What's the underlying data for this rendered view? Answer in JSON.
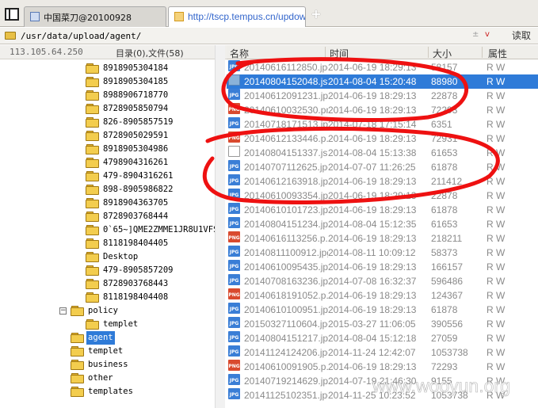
{
  "tabs": [
    {
      "label": "中国菜刀@20100928",
      "active": false
    },
    {
      "label": "http://tscp.tempus.cn/updow...",
      "active": true
    }
  ],
  "new_tab_symbol": "+",
  "pathbar": {
    "path": "/usr/data/upload/agent/",
    "dropdown_symbol": "±",
    "dropdown_arrow": "v",
    "read_label": "读取"
  },
  "status": {
    "ip": "113.105.64.250",
    "dir_count": "目录(0),文件(58)"
  },
  "tree": {
    "numbered_folders": [
      "8918905304184",
      "8918905304185",
      "8988906718770",
      "8728905850794",
      "826-8905857519",
      "8728905029591",
      "8918905304986",
      "4798904316261",
      "479-8904316261",
      "898-8905986822",
      "8918904363705",
      "8728903768444",
      "0`65~]QME2ZMME1JR8U1VFS",
      "8118198404405",
      "Desktop",
      "479-8905857209",
      "8728903768443",
      "8118198404408"
    ],
    "policy": {
      "label": "policy",
      "expander": "−"
    },
    "templet_child": "templet",
    "agent": "agent",
    "bottom_folders": [
      "templet",
      "business",
      "other",
      "templates"
    ]
  },
  "list_header": {
    "name": "名称",
    "time": "时间",
    "size": "大小",
    "attr": "属性"
  },
  "files": [
    {
      "icon": "jpg",
      "name": "20140616112850.jpg",
      "time": "2014-06-19 18:29:13",
      "size": "58157",
      "attr": "R W"
    },
    {
      "icon": "img",
      "name": "20140804152048.jsp",
      "time": "2014-08-04 15:20:48",
      "size": "88980",
      "attr": "R W",
      "selected": true
    },
    {
      "icon": "jpg",
      "name": "20140612091231.jpg",
      "time": "2014-06-19 18:29:13",
      "size": "22878",
      "attr": "R W"
    },
    {
      "icon": "png",
      "name": "20140610032530.png",
      "time": "2014-06-19 18:29:13",
      "size": "72293",
      "attr": "R W"
    },
    {
      "icon": "jpg",
      "name": "20140718171513.jpg",
      "time": "2014-07-18 17:15:14",
      "size": "6351",
      "attr": "R W"
    },
    {
      "icon": "png",
      "name": "20140612133446.p...",
      "time": "2014-06-19 18:29:13",
      "size": "72931",
      "attr": "R W"
    },
    {
      "icon": "blank",
      "name": "20140804151337.jsp",
      "time": "2014-08-04 15:13:38",
      "size": "61653",
      "attr": "R W"
    },
    {
      "icon": "jpg",
      "name": "20140707112625.jpg",
      "time": "2014-07-07 11:26:25",
      "size": "61878",
      "attr": "R W"
    },
    {
      "icon": "jpg",
      "name": "20140612163918.jpg",
      "time": "2014-06-19 18:29:13",
      "size": "211412",
      "attr": "R W"
    },
    {
      "icon": "jpg",
      "name": "20140610093354.jpg",
      "time": "2014-06-19 18:29:13",
      "size": "22878",
      "attr": "R W"
    },
    {
      "icon": "jpg",
      "name": "20140610101723.jpg",
      "time": "2014-06-19 18:29:13",
      "size": "61878",
      "attr": "R W"
    },
    {
      "icon": "jpg",
      "name": "20140804151234.jpg",
      "time": "2014-08-04 15:12:35",
      "size": "61653",
      "attr": "R W"
    },
    {
      "icon": "png",
      "name": "20140616113256.p...",
      "time": "2014-06-19 18:29:13",
      "size": "218211",
      "attr": "R W"
    },
    {
      "icon": "jpg",
      "name": "20140811100912.jpg",
      "time": "2014-08-11 10:09:12",
      "size": "58373",
      "attr": "R W"
    },
    {
      "icon": "jpg",
      "name": "20140610095435.jpg",
      "time": "2014-06-19 18:29:13",
      "size": "166157",
      "attr": "R W"
    },
    {
      "icon": "jpg",
      "name": "20140708163236.jpg",
      "time": "2014-07-08 16:32:37",
      "size": "596486",
      "attr": "R W"
    },
    {
      "icon": "png",
      "name": "20140618191052.p...",
      "time": "2014-06-19 18:29:13",
      "size": "124367",
      "attr": "R W"
    },
    {
      "icon": "jpg",
      "name": "20140610100951.jpg",
      "time": "2014-06-19 18:29:13",
      "size": "61878",
      "attr": "R W"
    },
    {
      "icon": "jpg",
      "name": "20150327110604.jpg",
      "time": "2015-03-27 11:06:05",
      "size": "390556",
      "attr": "R W"
    },
    {
      "icon": "jpg",
      "name": "20140804151217.jpg",
      "time": "2014-08-04 15:12:18",
      "size": "27059",
      "attr": "R W"
    },
    {
      "icon": "jpg",
      "name": "20141124124206.jpg",
      "time": "2014-11-24 12:42:07",
      "size": "1053738",
      "attr": "R W"
    },
    {
      "icon": "png",
      "name": "20140610091905.p...",
      "time": "2014-06-19 18:29:13",
      "size": "72293",
      "attr": "R W"
    },
    {
      "icon": "jpg",
      "name": "20140719214629.jpg",
      "time": "2014-07-19 21:46:30",
      "size": "9155",
      "attr": "R W"
    },
    {
      "icon": "jpg",
      "name": "20141125102351.jpg",
      "time": "2014-11-25 10:23:52",
      "size": "1053738",
      "attr": "R W"
    }
  ],
  "file_icon_labels": {
    "jpg": "JPG",
    "png": "PNG",
    "img": "",
    "blank": ""
  },
  "watermark": "www.wooyun.org",
  "colors": {
    "selection": "#2f7bd8",
    "annotation": "#ee1111"
  }
}
